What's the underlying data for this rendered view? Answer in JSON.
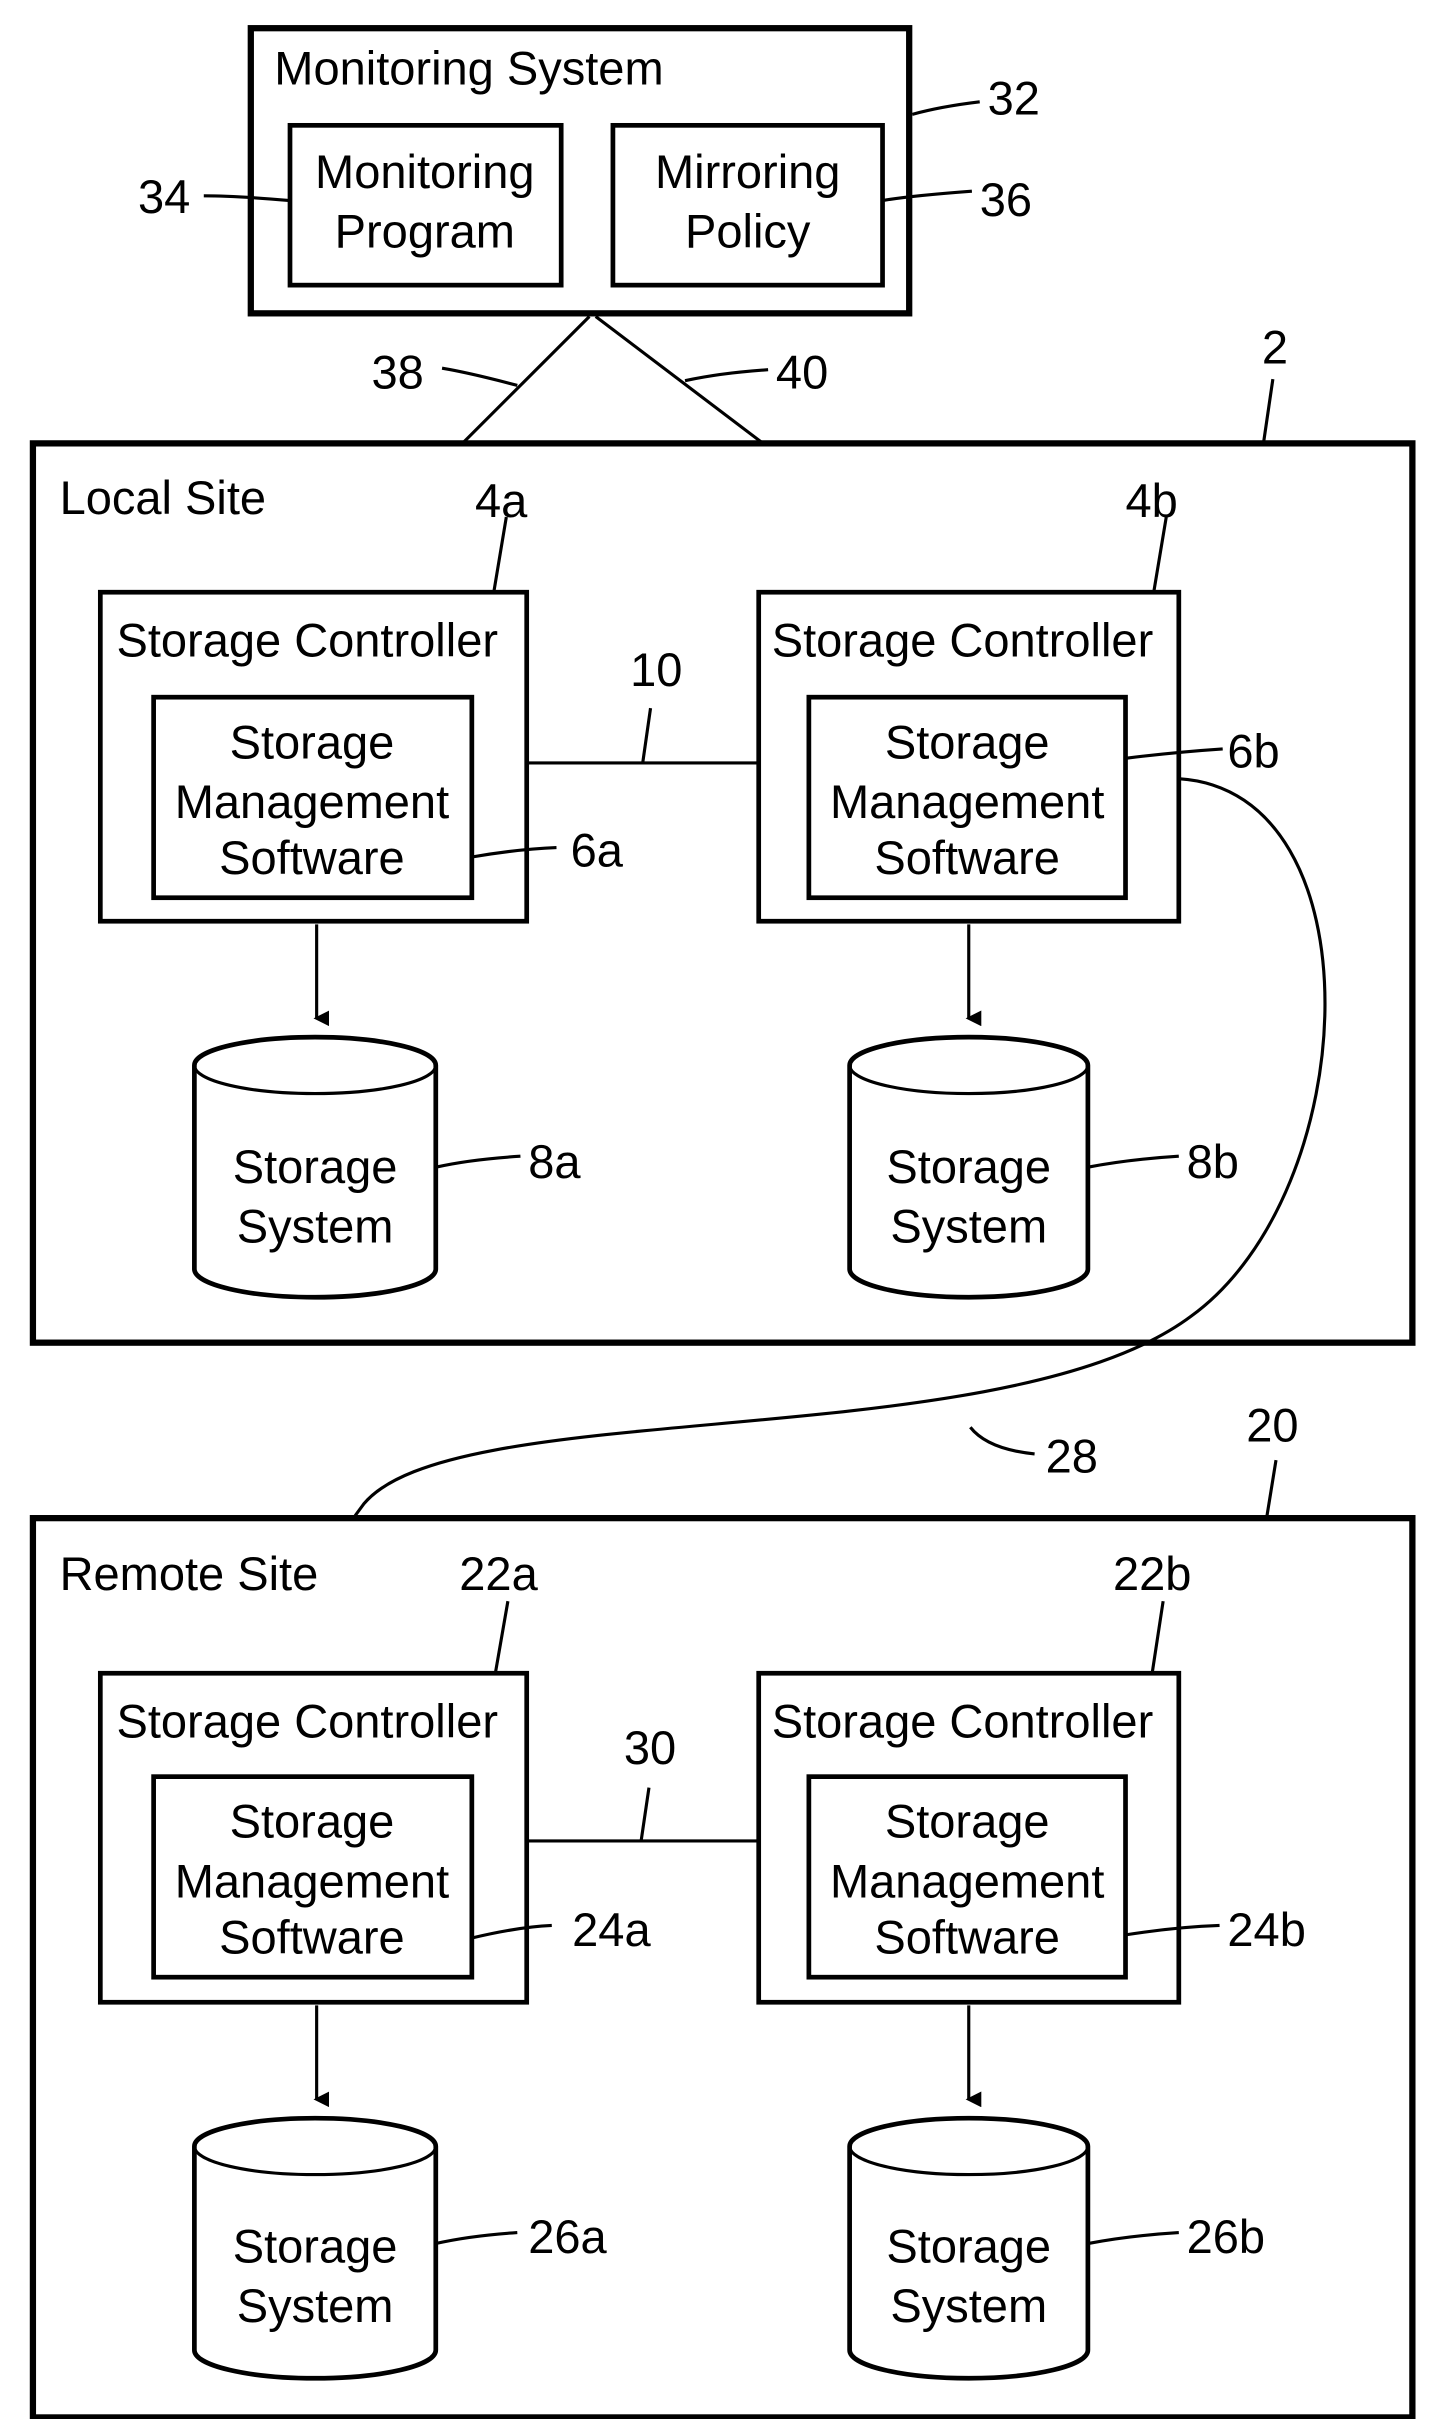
{
  "monitoring_system": {
    "title": "Monitoring System",
    "ref": "32",
    "monitoring_program": {
      "line1": "Monitoring",
      "line2": "Program",
      "ref": "34"
    },
    "mirroring_policy": {
      "line1": "Mirroring",
      "line2": "Policy",
      "ref": "36"
    },
    "link_left_ref": "38",
    "link_right_ref": "40"
  },
  "local_site": {
    "title": "Local Site",
    "ref": "2",
    "interconnect_ref": "10",
    "controllers": [
      {
        "title": "Storage Controller",
        "ref": "4a",
        "software": {
          "line1": "Storage",
          "line2": "Management",
          "line3": "Software",
          "ref": "6a"
        },
        "storage": {
          "line1": "Storage",
          "line2": "System",
          "ref": "8a"
        }
      },
      {
        "title": "Storage Controller",
        "ref": "4b",
        "software": {
          "line1": "Storage",
          "line2": "Management",
          "line3": "Software",
          "ref": "6b"
        },
        "storage": {
          "line1": "Storage",
          "line2": "System",
          "ref": "8b"
        }
      }
    ]
  },
  "remote_link_ref": "28",
  "remote_site": {
    "title": "Remote Site",
    "ref": "20",
    "interconnect_ref": "30",
    "controllers": [
      {
        "title": "Storage Controller",
        "ref": "22a",
        "software": {
          "line1": "Storage",
          "line2": "Management",
          "line3": "Software",
          "ref": "24a"
        },
        "storage": {
          "line1": "Storage",
          "line2": "System",
          "ref": "26a"
        }
      },
      {
        "title": "Storage Controller",
        "ref": "22b",
        "software": {
          "line1": "Storage",
          "line2": "Management",
          "line3": "Software",
          "ref": "24b"
        },
        "storage": {
          "line1": "Storage",
          "line2": "System",
          "ref": "26b"
        }
      }
    ]
  }
}
